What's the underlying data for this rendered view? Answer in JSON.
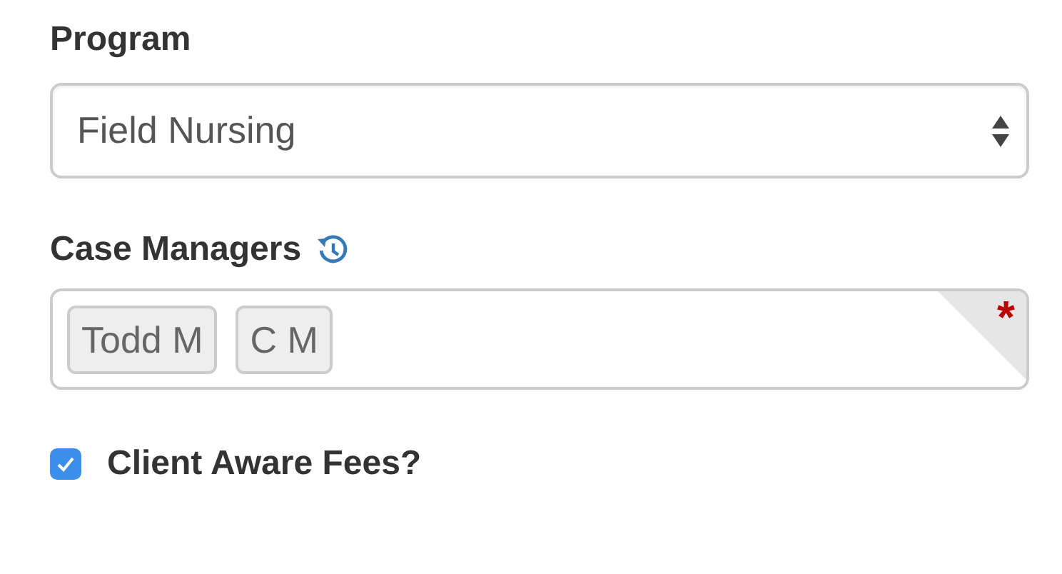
{
  "program": {
    "label": "Program",
    "value": "Field Nursing"
  },
  "case_managers": {
    "label": "Case Managers",
    "required": true,
    "required_mark": "*",
    "tags": [
      {
        "label": "Todd M"
      },
      {
        "label": "C M"
      }
    ]
  },
  "client_aware_fees": {
    "label": "Client Aware Fees?",
    "checked": true
  }
}
